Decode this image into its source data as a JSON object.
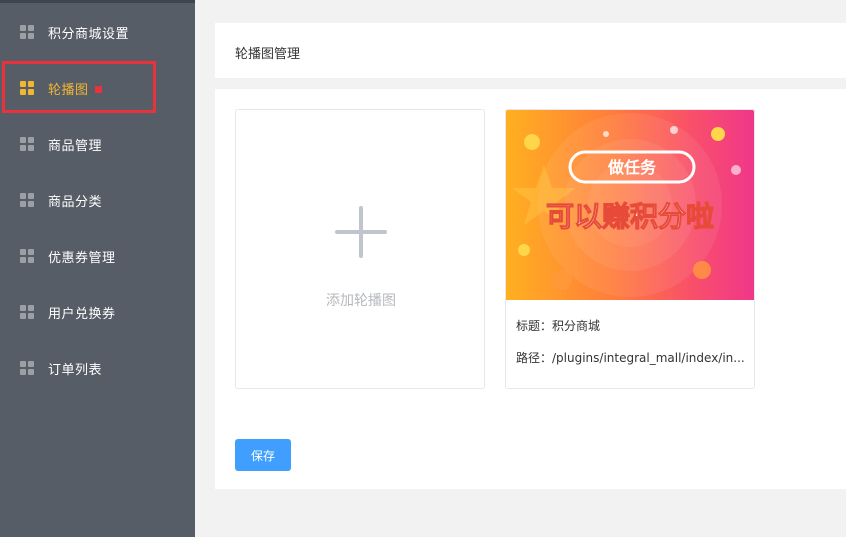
{
  "sidebar": {
    "items": [
      {
        "label": "积分商城设置",
        "icon": "grid-icon",
        "active": false
      },
      {
        "label": "轮播图",
        "icon": "grid-icon",
        "active": true
      },
      {
        "label": "商品管理",
        "icon": "grid-icon",
        "active": false
      },
      {
        "label": "商品分类",
        "icon": "grid-icon",
        "active": false
      },
      {
        "label": "优惠券管理",
        "icon": "grid-icon",
        "active": false
      },
      {
        "label": "用户兑换券",
        "icon": "grid-icon",
        "active": false
      },
      {
        "label": "订单列表",
        "icon": "grid-icon",
        "active": false
      }
    ]
  },
  "header": {
    "title": "轮播图管理"
  },
  "main": {
    "add_card": {
      "label": "添加轮播图",
      "icon": "plus-icon"
    },
    "banner": {
      "image_text_top": "做任务",
      "image_text_main": "可以赚积分啦",
      "title_line": "标题：积分商城",
      "path_line": "路径：/plugins/integral_mall/index/in..."
    },
    "save_label": "保存"
  },
  "colors": {
    "sidebar_bg": "#565d66",
    "active_accent": "#f2b632",
    "highlight_red": "#e8323c",
    "primary_button": "#409eff"
  }
}
